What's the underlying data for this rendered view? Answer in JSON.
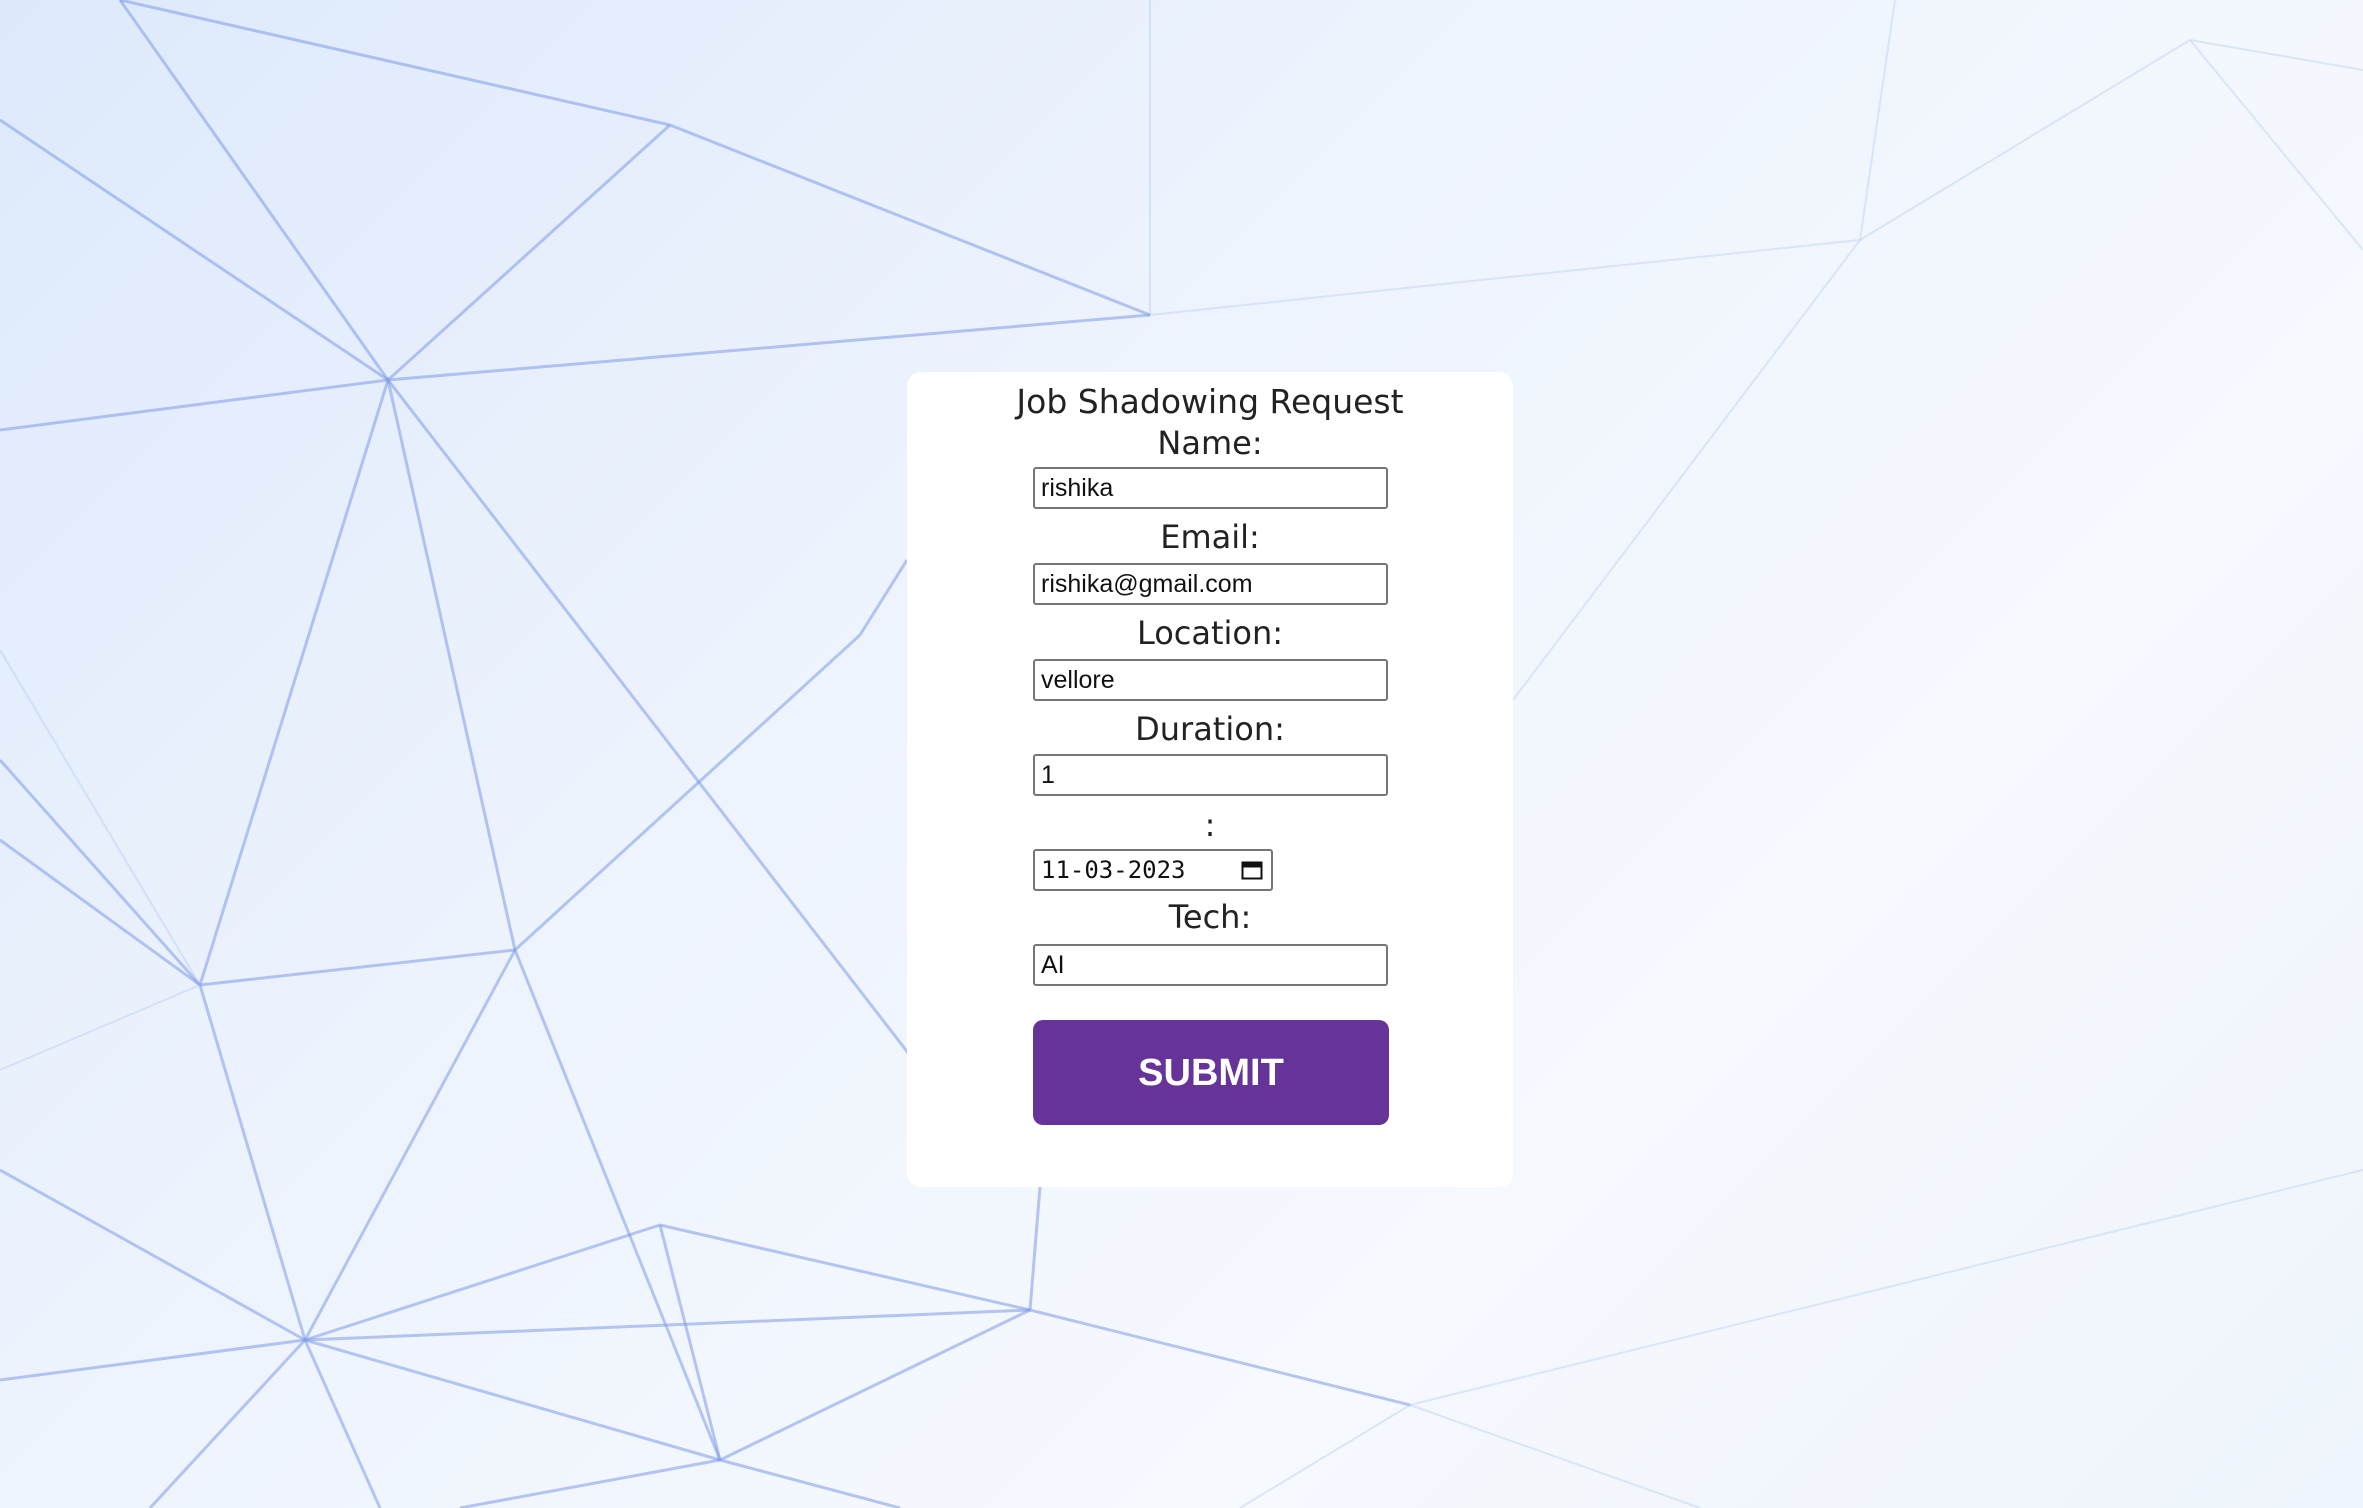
{
  "form": {
    "title": "Job Shadowing Request",
    "name_label": "Name:",
    "name_value": "rishika",
    "email_label": "Email:",
    "email_value": "rishika@gmail.com",
    "location_label": "Location:",
    "location_value": "vellore",
    "duration_label": "Duration:",
    "duration_value": "1",
    "date_label": ":",
    "date_value": "11-03-2023",
    "tech_label": "Tech:",
    "tech_value": "AI",
    "submit_label": "SUBMIT"
  },
  "colors": {
    "submit_bg": "#663399",
    "card_bg": "#ffffff"
  },
  "icons": {
    "date_picker": "calendar-icon"
  }
}
